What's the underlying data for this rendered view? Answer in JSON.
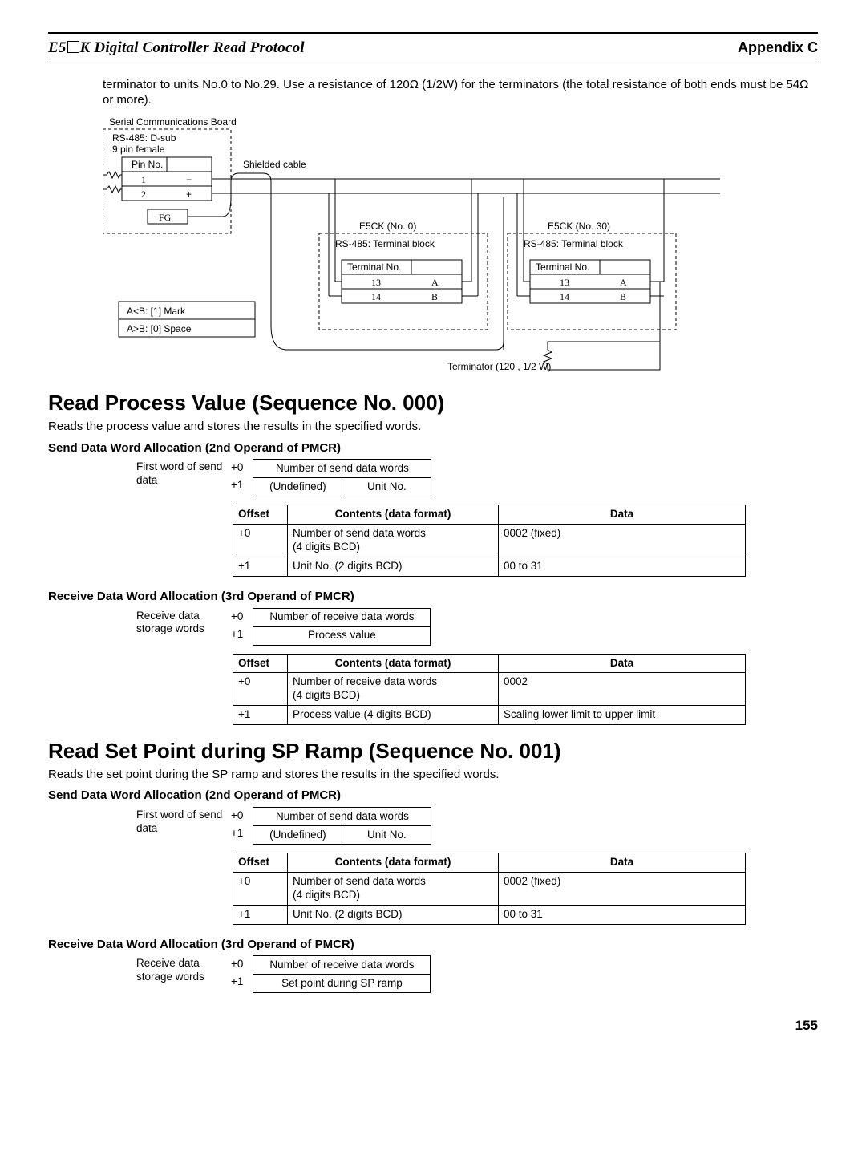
{
  "header": {
    "left_prefix": "E5",
    "left_suffix": "K Digital Controller Read Protocol",
    "right": "Appendix C"
  },
  "intro": "terminator to units No.0 to No.29. Use a resistance of 120Ω (1/2W) for the terminators (the total resistance of both ends must be 54Ω or more).",
  "diagram": {
    "board_title": "Serial Communications Board",
    "connector_label": "RS-485: D-sub\n9 pin female",
    "pin_header": "Pin No.",
    "pin_rows": [
      {
        "no": "1",
        "sig": "−"
      },
      {
        "no": "2",
        "sig": "+"
      }
    ],
    "fg": "FG",
    "shielded": "Shielded cable",
    "mark_rows": [
      "A<B:   [1]   Mark",
      "A>B:   [0]   Space"
    ],
    "block0_title": "E5CK (No. 0)",
    "block30_title": "E5CK (No. 30)",
    "term_block": "RS-485: Terminal block",
    "term_header": "Terminal No.",
    "term_rows": [
      {
        "no": "13",
        "sig": "A"
      },
      {
        "no": "14",
        "sig": "B"
      }
    ],
    "terminator_note": "Terminator (120  , 1/2 W)"
  },
  "sec0": {
    "title": "Read Process Value (Sequence No. 000)",
    "desc": "Reads the process value and stores the results in the specified words.",
    "send_sub": "Send Data Word Allocation (2nd Operand of PMCR)",
    "send_label": "First word of send data",
    "send_rows": {
      "r0": "Number of send data words",
      "r1a": "(Undefined)",
      "r1b": "Unit No."
    },
    "send_spec": {
      "h_off": "Offset",
      "h_cont": "Contents (data format)",
      "h_data": "Data",
      "rows": [
        {
          "o": "+0",
          "c": "Number of send data words\n(4 digits BCD)",
          "d": "0002 (fixed)"
        },
        {
          "o": "+1",
          "c": "Unit No. (2 digits BCD)",
          "d": "00 to 31"
        }
      ]
    },
    "recv_sub": "Receive Data Word Allocation (3rd Operand of PMCR)",
    "recv_label": "Receive data storage words",
    "recv_rows": {
      "r0": "Number of receive data words",
      "r1": "Process value"
    },
    "recv_spec": {
      "h_off": "Offset",
      "h_cont": "Contents (data format)",
      "h_data": "Data",
      "rows": [
        {
          "o": "+0",
          "c": "Number of receive data words\n(4 digits BCD)",
          "d": "0002"
        },
        {
          "o": "+1",
          "c": "Process value (4 digits BCD)",
          "d": "Scaling lower limit to upper limit"
        }
      ]
    }
  },
  "sec1": {
    "title": "Read Set Point during SP Ramp (Sequence No. 001)",
    "desc": "Reads the set point during the SP ramp and stores the results in the specified words.",
    "send_sub": "Send Data Word Allocation (2nd Operand of PMCR)",
    "send_label": "First word of send data",
    "send_rows": {
      "r0": "Number of send data words",
      "r1a": "(Undefined)",
      "r1b": "Unit No."
    },
    "send_spec": {
      "h_off": "Offset",
      "h_cont": "Contents (data format)",
      "h_data": "Data",
      "rows": [
        {
          "o": "+0",
          "c": "Number of send data words\n(4 digits BCD)",
          "d": "0002 (fixed)"
        },
        {
          "o": "+1",
          "c": "Unit No. (2 digits BCD)",
          "d": "00 to 31"
        }
      ]
    },
    "recv_sub": "Receive Data Word Allocation (3rd Operand of PMCR)",
    "recv_label": "Receive data storage words",
    "recv_rows": {
      "r0": "Number of receive data words",
      "r1": "Set point during SP ramp"
    }
  },
  "page_no": "155"
}
